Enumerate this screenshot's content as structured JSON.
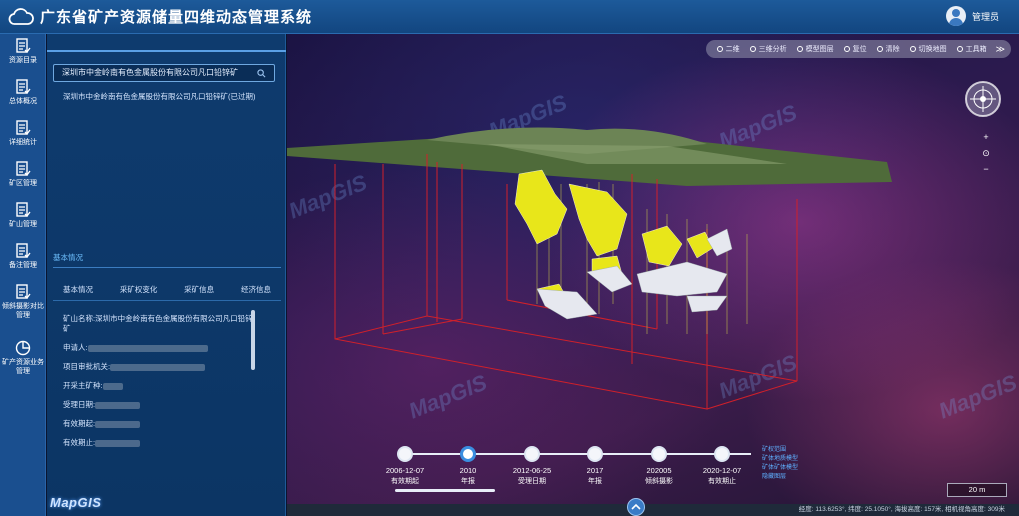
{
  "header": {
    "title": "广东省矿产资源储量四维动态管理系统",
    "user": "管理员"
  },
  "nav": {
    "items": [
      {
        "label": "资源目录"
      },
      {
        "label": "总体概况"
      },
      {
        "label": "详细统计"
      },
      {
        "label": "矿区管理"
      },
      {
        "label": "矿山管理"
      },
      {
        "label": "备注管理"
      },
      {
        "label": "倾斜摄影对比管理"
      },
      {
        "label": "矿产资源业务管理"
      }
    ],
    "logo": "MapGIS"
  },
  "panel": {
    "search_value": "深圳市中金岭南有色金属股份有限公司凡口铅锌矿",
    "result": "深圳市中金岭南有色金属股份有限公司凡口铅锌矿(已过期)",
    "section_title": "基本情况",
    "tabs": [
      "基本情况",
      "采矿权变化",
      "采矿信息",
      "经济信息"
    ],
    "info": {
      "mine_name": "矿山名称:深圳市中金岭南有色金属股份有限公司凡口铅锌矿",
      "applicant": "申请人:",
      "approval_org": "项目审批机关:",
      "main_mineral": "开采主矿种:",
      "accept_date": "受理日期:",
      "valid_start": "有效期起:",
      "valid_end": "有效期止:"
    }
  },
  "toolbar": {
    "tools": [
      "二维",
      "三维分析",
      "模型图层",
      "复位",
      "清除",
      "切换地图",
      "工具箱"
    ],
    "more": "≫"
  },
  "controls": {
    "zoom_in": "+",
    "reset": "⊙",
    "zoom_out": "−"
  },
  "watermark": "MapGIS",
  "timeline": {
    "nodes": [
      {
        "date": "2006-12-07",
        "label": "有效期起",
        "active": false
      },
      {
        "date": "2010",
        "label": "年报",
        "active": true
      },
      {
        "date": "2012-06-25",
        "label": "受理日期",
        "active": false
      },
      {
        "date": "2017",
        "label": "年报",
        "active": false
      },
      {
        "date": "202005",
        "label": "倾斜摄影",
        "active": false
      },
      {
        "date": "2020-12-07",
        "label": "有效期止",
        "active": false
      }
    ],
    "legend": [
      "矿权范围",
      "矿体地质模型",
      "矿体矿体模型",
      "隐藏图层"
    ]
  },
  "scale": "20 m",
  "statusbar": "经度: 113.6253°, 纬度: 25.1050°, 海拔高度: 157米, 相机视角高度: 309米",
  "colors": {
    "accent": "#3a8ee0",
    "header": "#1d5a9a",
    "panel": "#0e3b6e",
    "ore": "#e8e61a"
  }
}
